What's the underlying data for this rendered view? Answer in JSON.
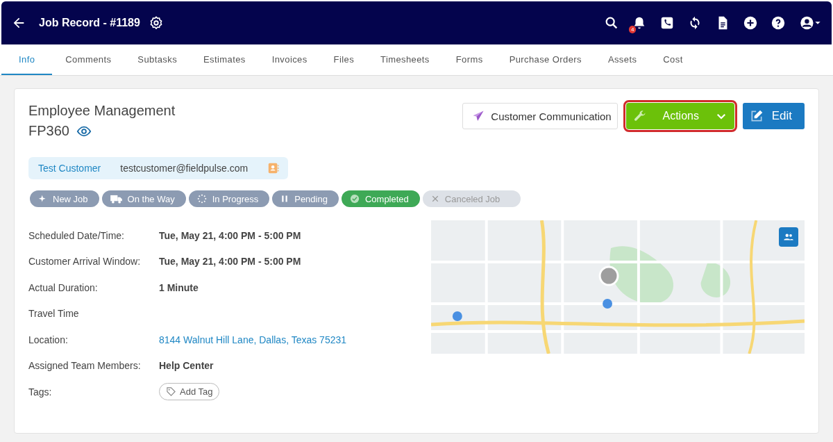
{
  "header": {
    "title": "Job Record - #1189",
    "notification_count": "4"
  },
  "tabs": [
    {
      "label": "Info",
      "selected": true
    },
    {
      "label": "Comments",
      "selected": false
    },
    {
      "label": "Subtasks",
      "selected": false
    },
    {
      "label": "Estimates",
      "selected": false
    },
    {
      "label": "Invoices",
      "selected": false
    },
    {
      "label": "Files",
      "selected": false
    },
    {
      "label": "Timesheets",
      "selected": false
    },
    {
      "label": "Forms",
      "selected": false
    },
    {
      "label": "Purchase Orders",
      "selected": false
    },
    {
      "label": "Assets",
      "selected": false
    },
    {
      "label": "Cost",
      "selected": false
    }
  ],
  "job": {
    "title": "Employee Management",
    "code": "FP360"
  },
  "buttons": {
    "communication": "Customer Communication",
    "actions": {
      "label": "Actions",
      "highlighted": true
    },
    "edit": "Edit"
  },
  "customer": {
    "name": "Test Customer",
    "email": "testcustomer@fieldpulse.com"
  },
  "statuses": [
    {
      "label": "New Job",
      "kind": "sparkle",
      "selected": false,
      "disabled": false
    },
    {
      "label": "On the Way",
      "kind": "truck",
      "selected": false,
      "disabled": false
    },
    {
      "label": "In Progress",
      "kind": "spinner",
      "selected": false,
      "disabled": false
    },
    {
      "label": "Pending",
      "kind": "pause",
      "selected": false,
      "disabled": false
    },
    {
      "label": "Completed",
      "kind": "check",
      "selected": true,
      "disabled": false
    },
    {
      "label": "Canceled Job",
      "kind": "cross",
      "selected": false,
      "disabled": true
    }
  ],
  "details": [
    {
      "label": "Scheduled Date/Time:",
      "value": "Tue, May 21, 4:00 PM - 5:00 PM",
      "kind": "text"
    },
    {
      "label": "Customer Arrival Window:",
      "value": "Tue, May 21, 4:00 PM - 5:00 PM",
      "kind": "text"
    },
    {
      "label": "Actual Duration:",
      "value": "1 Minute",
      "kind": "text"
    },
    {
      "label": "Travel Time"
    },
    {
      "label": "Location:",
      "value": "8144 Walnut Hill Lane, Dallas, Texas 75231",
      "kind": "link"
    },
    {
      "label": "Assigned Team Members:",
      "value": "Help Center",
      "kind": "text"
    },
    {
      "label": "Tags:",
      "value": "Add Tag",
      "kind": "tag"
    }
  ]
}
